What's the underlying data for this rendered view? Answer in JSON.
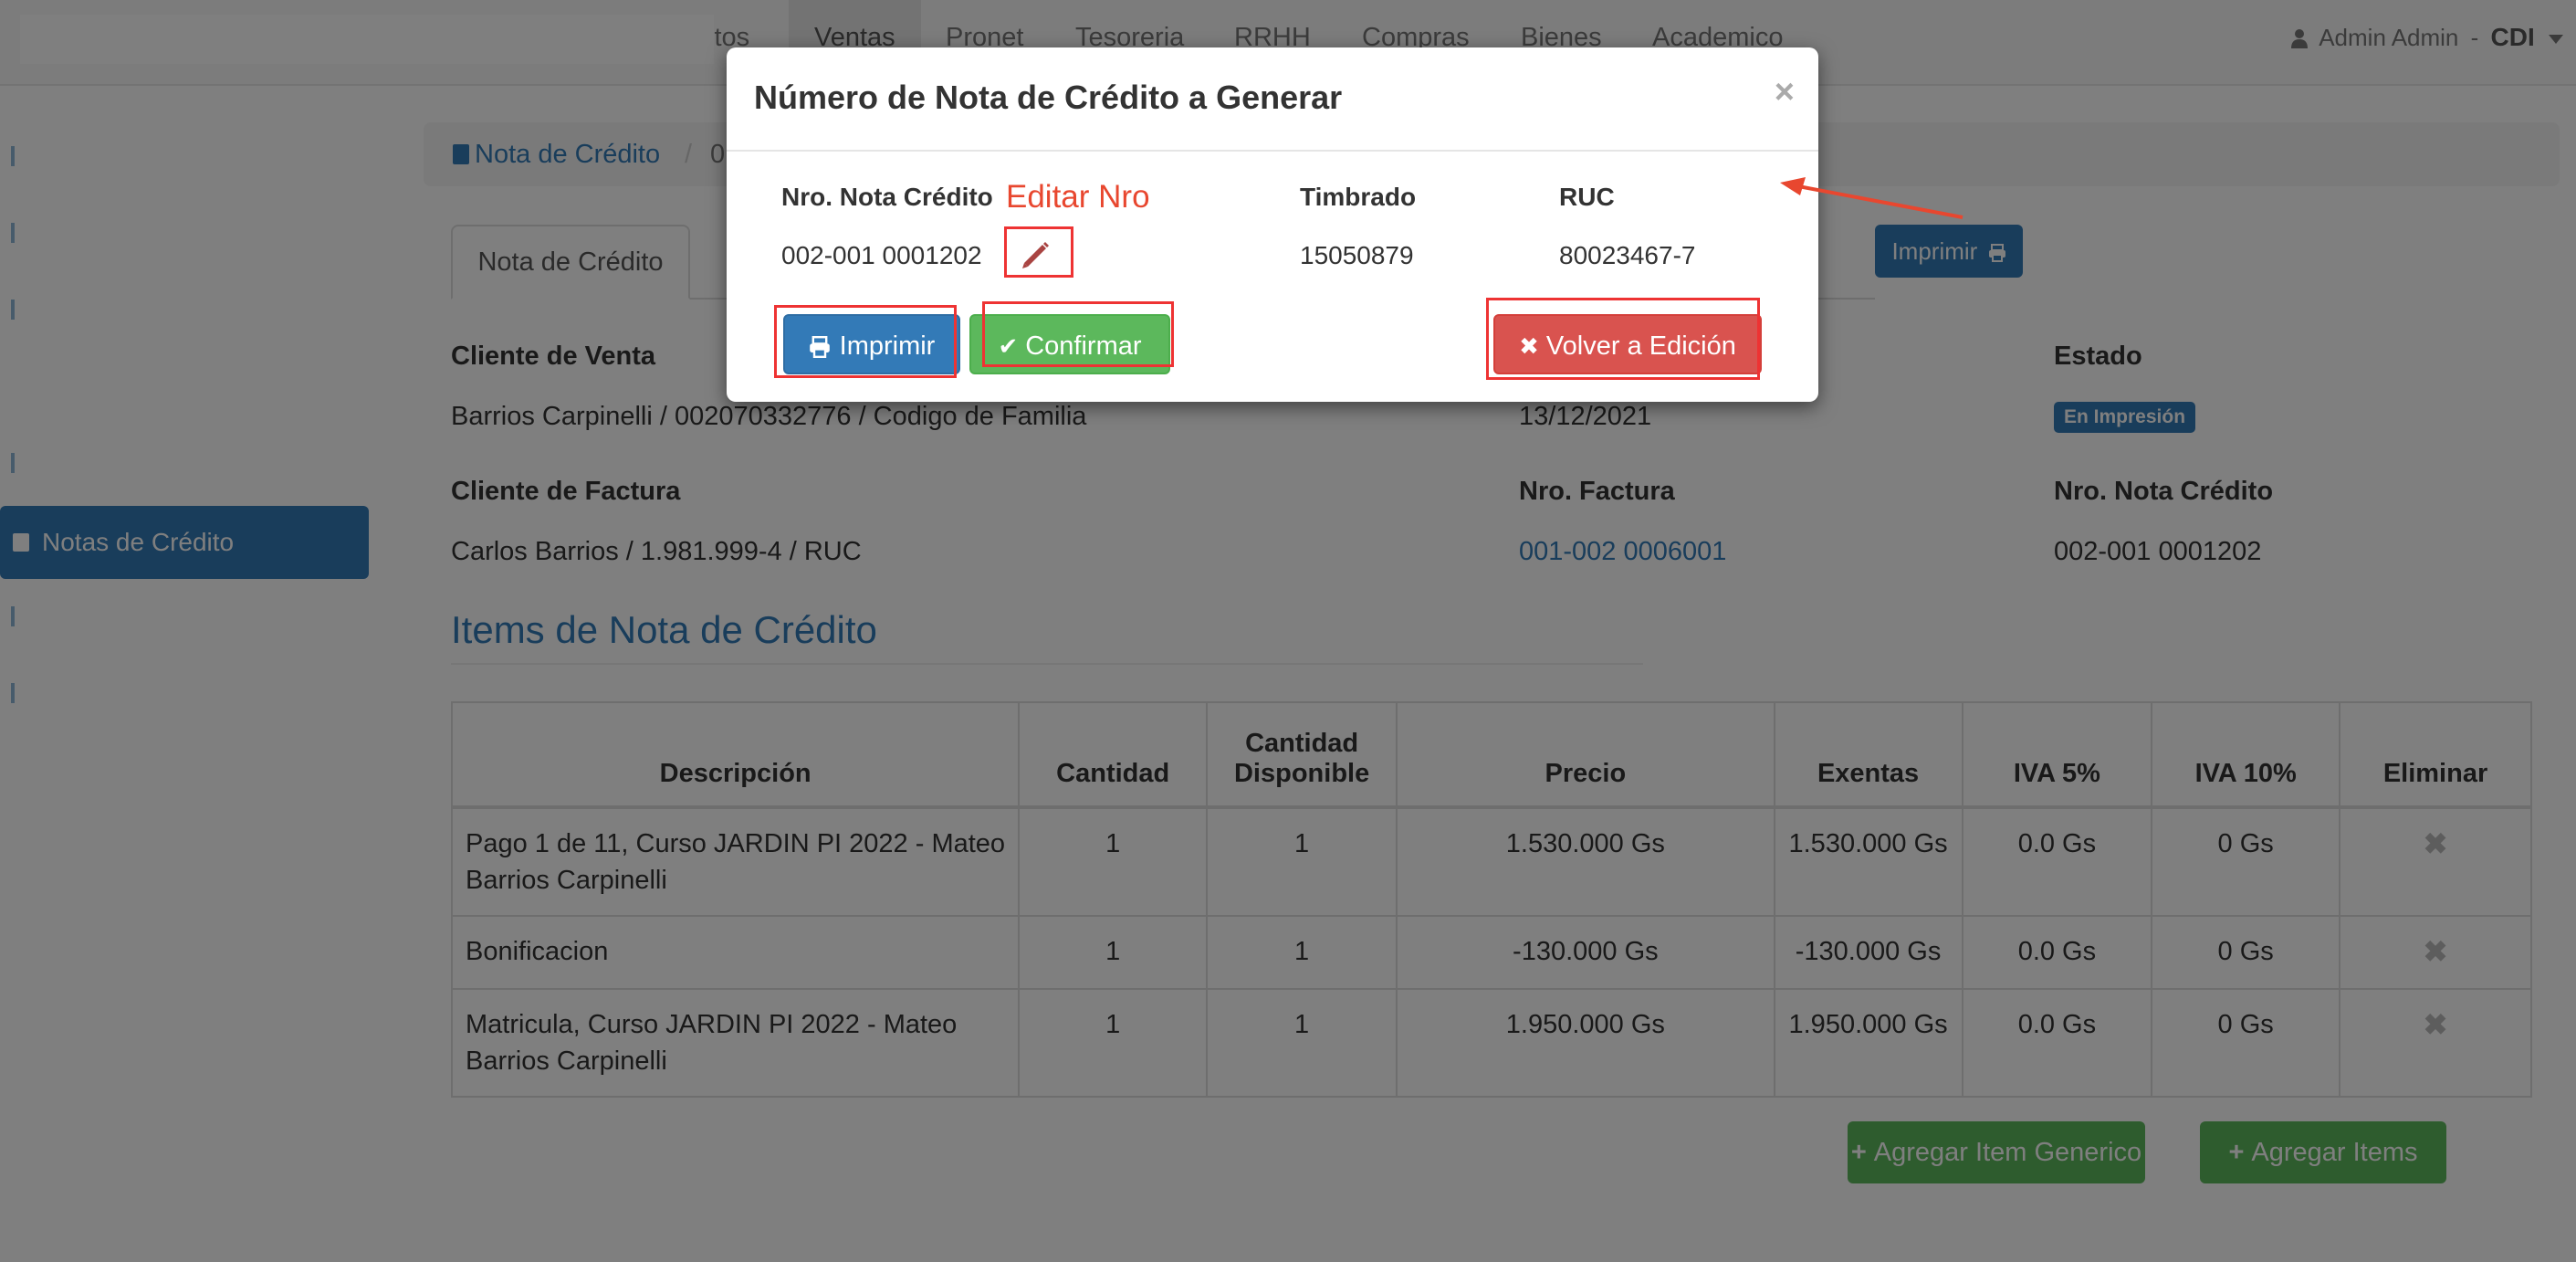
{
  "navbar": {
    "items": [
      "ctos",
      "Ventas",
      "Pronet",
      "Tesoreria",
      "RRHH",
      "Compras",
      "Bienes",
      "Academico"
    ],
    "active_index": 1,
    "user": "Admin Admin",
    "separator": "-",
    "company": "CDI"
  },
  "sidebar": {
    "active_label": "Notas de Crédito"
  },
  "breadcrumb": {
    "link": "Nota de Crédito",
    "separator": "/",
    "next": "0"
  },
  "tabs": {
    "active": "Nota de Crédito",
    "print_button": "Imprimir"
  },
  "info": {
    "cliente_venta_label": "Cliente de Venta",
    "cliente_venta_value": "Barrios Carpinelli / 002070332776 / Codigo de Familia",
    "fecha_value": "13/12/2021",
    "estado_label": "Estado",
    "estado_badge": "En Impresión",
    "cliente_factura_label": "Cliente de Factura",
    "cliente_factura_value": "Carlos Barrios / 1.981.999-4 / RUC",
    "nro_factura_label": "Nro. Factura",
    "nro_factura_value": "001-002 0006001",
    "nro_nota_label": "Nro. Nota Crédito",
    "nro_nota_value": "002-001 0001202"
  },
  "items_section": {
    "title": "Items de Nota de Crédito",
    "columns": [
      "Descripción",
      "Cantidad",
      "Cantidad Disponible",
      "Precio",
      "Exentas",
      "IVA 5%",
      "IVA 10%",
      "Eliminar"
    ],
    "rows": [
      {
        "descripcion": "Pago 1 de 11, Curso JARDIN PI 2022 - Mateo Barrios Carpinelli",
        "cantidad": "1",
        "disponible": "1",
        "precio": "1.530.000 Gs",
        "exentas": "1.530.000 Gs",
        "iva5": "0.0 Gs",
        "iva10": "0 Gs"
      },
      {
        "descripcion": "Bonificacion",
        "cantidad": "1",
        "disponible": "1",
        "precio": "-130.000 Gs",
        "exentas": "-130.000 Gs",
        "iva5": "0.0 Gs",
        "iva10": "0 Gs"
      },
      {
        "descripcion": "Matricula, Curso JARDIN PI 2022 - Mateo Barrios Carpinelli",
        "cantidad": "1",
        "disponible": "1",
        "precio": "1.950.000 Gs",
        "exentas": "1.950.000 Gs",
        "iva5": "0.0 Gs",
        "iva10": "0 Gs"
      }
    ],
    "add_generic_button": "Agregar Item Generico",
    "add_items_button": "Agregar Items"
  },
  "modal": {
    "title": "Número de Nota de Crédito a Generar",
    "close": "×",
    "nro_label": "Nro. Nota Crédito",
    "nro_value": "002-001 0001202",
    "timbrado_label": "Timbrado",
    "timbrado_value": "15050879",
    "ruc_label": "RUC",
    "ruc_value": "80023467-7",
    "imprimir_button": "Imprimir",
    "confirmar_button": "Confirmar",
    "volver_button": "Volver a Edición"
  },
  "annotation": {
    "text": "Editar Nro",
    "color": "#e8472f"
  },
  "icons": {
    "print": "print-icon",
    "check": "check-icon",
    "times": "times-icon",
    "pencil": "pencil-icon",
    "user": "user-icon",
    "plus": "plus-icon"
  }
}
